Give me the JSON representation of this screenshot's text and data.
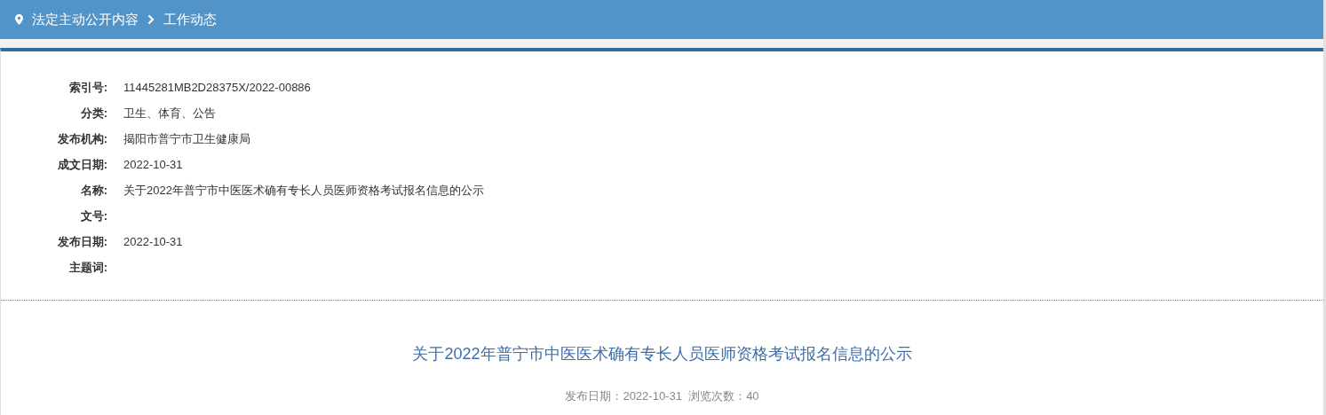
{
  "breadcrumb": [
    {
      "label": "法定主动公开内容"
    },
    {
      "label": "工作动态"
    }
  ],
  "meta": [
    {
      "label": "索引号:",
      "value": "11445281MB2D28375X/2022-00886"
    },
    {
      "label": "分类:",
      "value": "卫生、体育、公告"
    },
    {
      "label": "发布机构:",
      "value": "揭阳市普宁市卫生健康局"
    },
    {
      "label": "成文日期:",
      "value": "2022-10-31"
    },
    {
      "label": "名称:",
      "value": "关于2022年普宁市中医医术确有专长人员医师资格考试报名信息的公示"
    },
    {
      "label": "文号:"
    },
    {
      "label": "发布日期:",
      "value": "2022-10-31"
    },
    {
      "label": "主题词:"
    }
  ],
  "article": {
    "title": "关于2022年普宁市中医医术确有专长人员医师资格考试报名信息的公示",
    "info": "发布日期：2022-10-31  浏览次数：40"
  }
}
